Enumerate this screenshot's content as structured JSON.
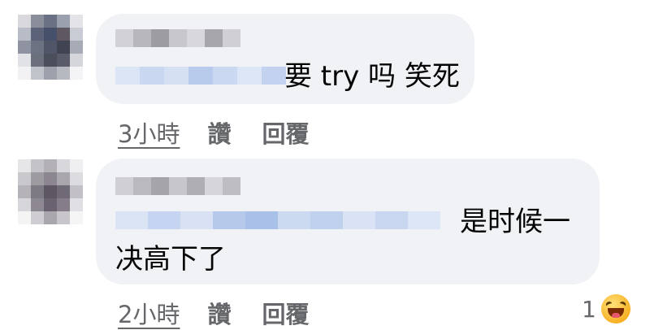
{
  "comments": [
    {
      "text": "要 try 吗 笑死",
      "time": "3小時",
      "like_label": "讚",
      "reply_label": "回覆"
    },
    {
      "text_line1": "是时候一",
      "text_line2": "决高下了",
      "time": "2小時",
      "like_label": "讚",
      "reply_label": "回覆",
      "reaction_count": "1",
      "reaction_icon": "haha-emoji-icon"
    }
  ]
}
